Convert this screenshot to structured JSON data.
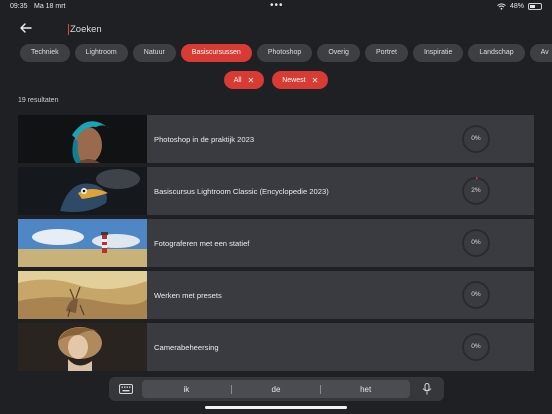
{
  "status_bar": {
    "time": "09:35",
    "date": "Ma 18 mrt",
    "battery": "48%"
  },
  "search": {
    "value": "Zoeken"
  },
  "categories": [
    "Techniek",
    "Lightroom",
    "Natuur",
    "Basiscursussen",
    "Photoshop",
    "Overig",
    "Portret",
    "Inspiratie",
    "Landschap",
    "Av"
  ],
  "active_category": "Basiscursussen",
  "filters": [
    {
      "label": "All"
    },
    {
      "label": "Newest"
    }
  ],
  "results_count": "19 resultaten",
  "courses": [
    {
      "title": "Photoshop in de praktijk 2023",
      "progress_label": "0%",
      "progress": 0
    },
    {
      "title": "Basiscursus Lightroom Classic (Encyclopedie 2023)",
      "progress_label": "2%",
      "progress": 2
    },
    {
      "title": "Fotograferen met een statief",
      "progress_label": "0%",
      "progress": 0
    },
    {
      "title": "Werken met presets",
      "progress_label": "0%",
      "progress": 0
    },
    {
      "title": "Camerabeheersing",
      "progress_label": "0%",
      "progress": 0
    }
  ],
  "keyboard_suggestions": [
    "ik",
    "de",
    "het"
  ],
  "colors": {
    "accent": "#d83a34",
    "background": "#1f2023",
    "card": "#3a3b40",
    "chip": "#3e3f43"
  },
  "icons": {
    "back": "arrow-left-icon",
    "close": "close-icon",
    "keyboard": "keyboard-icon",
    "mic": "microphone-icon",
    "wifi": "wifi-icon"
  }
}
